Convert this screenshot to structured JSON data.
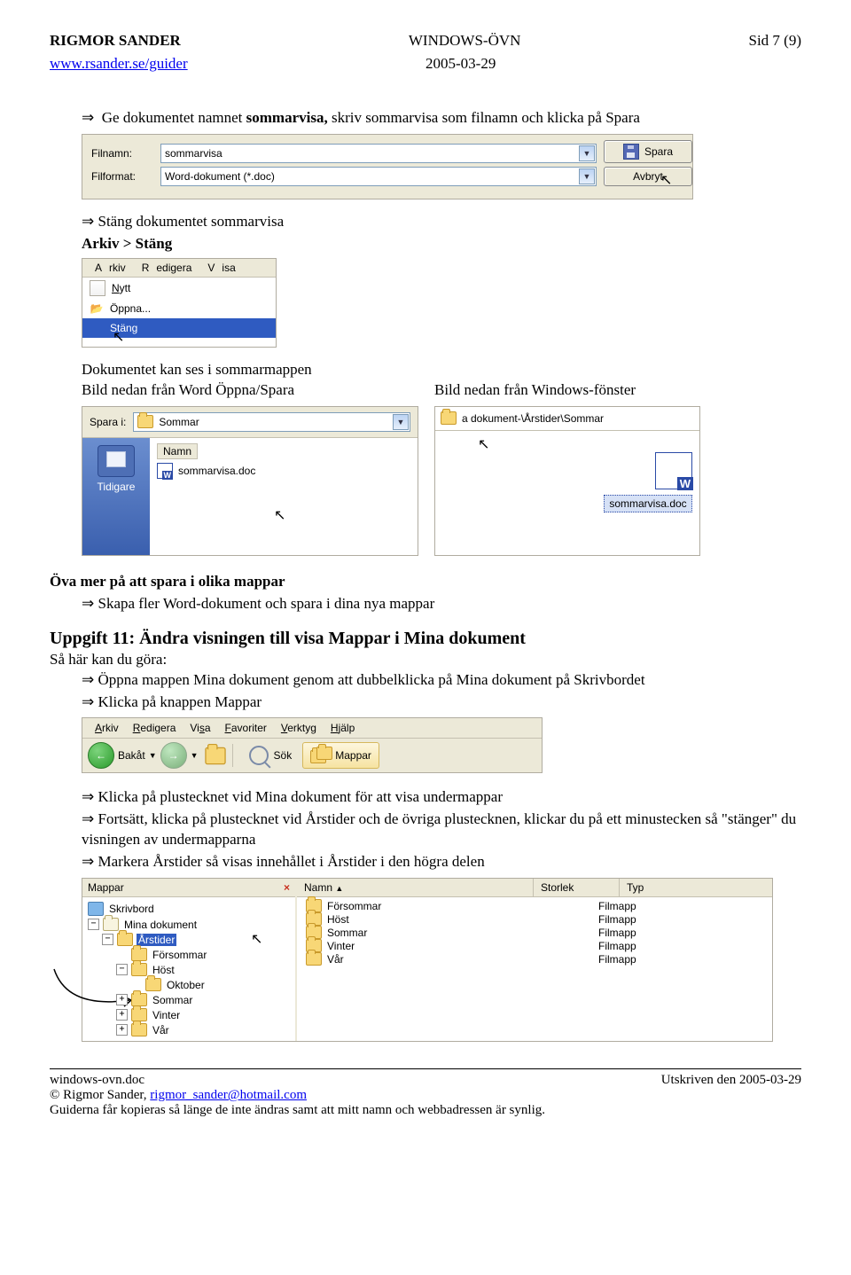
{
  "header": {
    "author": "RIGMOR SANDER",
    "title": "WINDOWS-ÖVN",
    "pageinfo": "Sid 7 (9)",
    "url_text": "www.rsander.se/guider",
    "date": "2005-03-29"
  },
  "p1": {
    "line1_pre": "Ge dokumentet namnet ",
    "line1_b1": "sommarvisa,",
    "line1_mid": " skriv sommarvisa som filnamn och klicka på Spara"
  },
  "save_dialog": {
    "filnamn_label": "Filnamn:",
    "filnamn_value": "sommarvisa",
    "filformat_label": "Filformat:",
    "filformat_value": "Word-dokument (*.doc)",
    "spara": "Spara",
    "avbryt": "Avbryt"
  },
  "p2": {
    "line1": "Stäng dokumentet sommarvisa",
    "line2": "Arkiv > Stäng"
  },
  "menu": {
    "arkiv": "Arkiv",
    "redigera": "Redigera",
    "visa": "Visa",
    "nytt": "Nytt",
    "oppna": "Öppna...",
    "stang": "Stäng"
  },
  "p3": {
    "line1": "Dokumentet kan ses i sommarmappen",
    "line2_left": "Bild nedan från Word Öppna/Spara",
    "line2_right": "Bild nedan från Windows-fönster"
  },
  "sparai_panel": {
    "label": "Spara i:",
    "folder": "Sommar",
    "side": "Tidigare",
    "col_name": "Namn",
    "file1": "sommarvisa.doc"
  },
  "addr_panel": {
    "path": "a dokument-\\Årstider\\Sommar",
    "file_caption": "sommarvisa.doc"
  },
  "section_ova": {
    "h": "Öva mer på att spara i olika mappar",
    "l1": "Skapa fler Word-dokument och spara i dina nya mappar"
  },
  "uppgift11": {
    "h": "Uppgift 11: Ändra visningen till visa Mappar i Mina dokument",
    "sub": "Så här kan du göra:",
    "l1": "Öppna mappen Mina dokument genom att dubbelklicka på Mina dokument på Skrivbordet",
    "l2": "Klicka på knappen Mappar"
  },
  "explorer_tb": {
    "m_arkiv": "Arkiv",
    "m_redigera": "Redigera",
    "m_visa": "Visa",
    "m_favoriter": "Favoriter",
    "m_verktyg": "Verktyg",
    "m_hjalp": "Hjälp",
    "back": "Bakåt",
    "sok": "Sök",
    "mappar": "Mappar"
  },
  "after_tb": {
    "l1": "Klicka på plustecknet vid Mina dokument för att visa undermappar",
    "l2": "Fortsätt, klicka på plustecknet vid Årstider och de övriga plustecknen, klickar du på ett minustecken så \"stänger\" du visningen av undermapparna",
    "l3": "Markera Årstider så visas innehållet i Årstider i den högra delen"
  },
  "tree": {
    "hdr": "Mappar",
    "skrivbord": "Skrivbord",
    "minadok": "Mina dokument",
    "arstider": "Årstider",
    "forsommar": "Försommar",
    "host": "Höst",
    "oktober": "Oktober",
    "sommar": "Sommar",
    "vinter": "Vinter",
    "var": "Vår"
  },
  "filelist": {
    "c_name": "Namn",
    "c_size": "Storlek",
    "c_type": "Typ",
    "type_val": "Filmapp",
    "rows": [
      "Försommar",
      "Höst",
      "Sommar",
      "Vinter",
      "Vår"
    ]
  },
  "footer": {
    "f1": "windows-ovn.doc",
    "f2a": "© Rigmor Sander, ",
    "f2b": "rigmor_sander@hotmail.com",
    "f3": "Guiderna får kopieras så länge de inte ändras samt att mitt namn och webbadressen är synlig.",
    "right": "Utskriven den 2005-03-29"
  }
}
